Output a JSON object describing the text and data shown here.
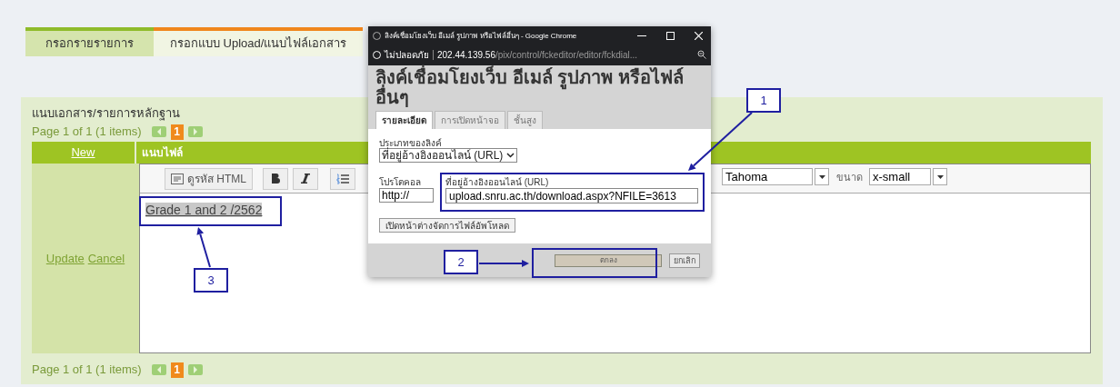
{
  "tabs": [
    {
      "label": "กรอกรายรายการ",
      "selected": false
    },
    {
      "label": "กรอกแบบ Upload/แนบไฟล์เอกสาร",
      "selected": true
    }
  ],
  "section_title": "แนบเอกสาร/รายการหลักฐาน",
  "pager_top": {
    "text": "Page 1 of 1 (1 items)",
    "current": "1"
  },
  "table": {
    "columns": [
      "New",
      "แนบไฟล์"
    ],
    "row": {
      "actions": [
        "Update",
        "Cancel"
      ],
      "editor": {
        "toolbar": {
          "source_button": "ดูรหัส HTML",
          "font": "Tahoma",
          "size_label": "ขนาด",
          "size": "x-small"
        },
        "link_text": "Grade 1 and 2 /2562"
      }
    }
  },
  "pager_bottom": {
    "text": "Page 1 of 1 (1 items)",
    "current": "1"
  },
  "dialog": {
    "window_title": "ลิงค์เชื่อมโยงเว็บ อีเมล์ รูปภาพ หรือไฟล์อื่นๆ - Google Chrome",
    "security": "ไม่ปลอดภัย",
    "url_host": "202.44.139.56",
    "url_path": "/pix/control/fckeditor/editor/fckdial...",
    "heading": "ลิงค์เชื่อมโยงเว็บ อีเมล์ รูปภาพ หรือไฟล์อื่นๆ",
    "tabs": [
      {
        "label": "รายละเอียด",
        "selected": true
      },
      {
        "label": "การเปิดหน้าจอ",
        "selected": false
      },
      {
        "label": "ชั้นสูง",
        "selected": false
      }
    ],
    "link_type_label": "ประเภทของลิงค์",
    "link_type": "ที่อยู่อ้างอิงออนไลน์ (URL)",
    "protocol_label": "โปรโตคอล",
    "protocol": "http://",
    "url_label": "ที่อยู่อ้างอิงออนไลน์ (URL)",
    "url": "upload.snru.ac.th/download.aspx?NFILE=3613",
    "browse_button": "เปิดหน้าต่างจัดการไฟล์อัพโหลด",
    "ok_button": "ตกลง",
    "cancel_button": "ยกเลิก"
  },
  "callouts": [
    {
      "label": "1"
    },
    {
      "label": "2"
    },
    {
      "label": "3"
    }
  ]
}
